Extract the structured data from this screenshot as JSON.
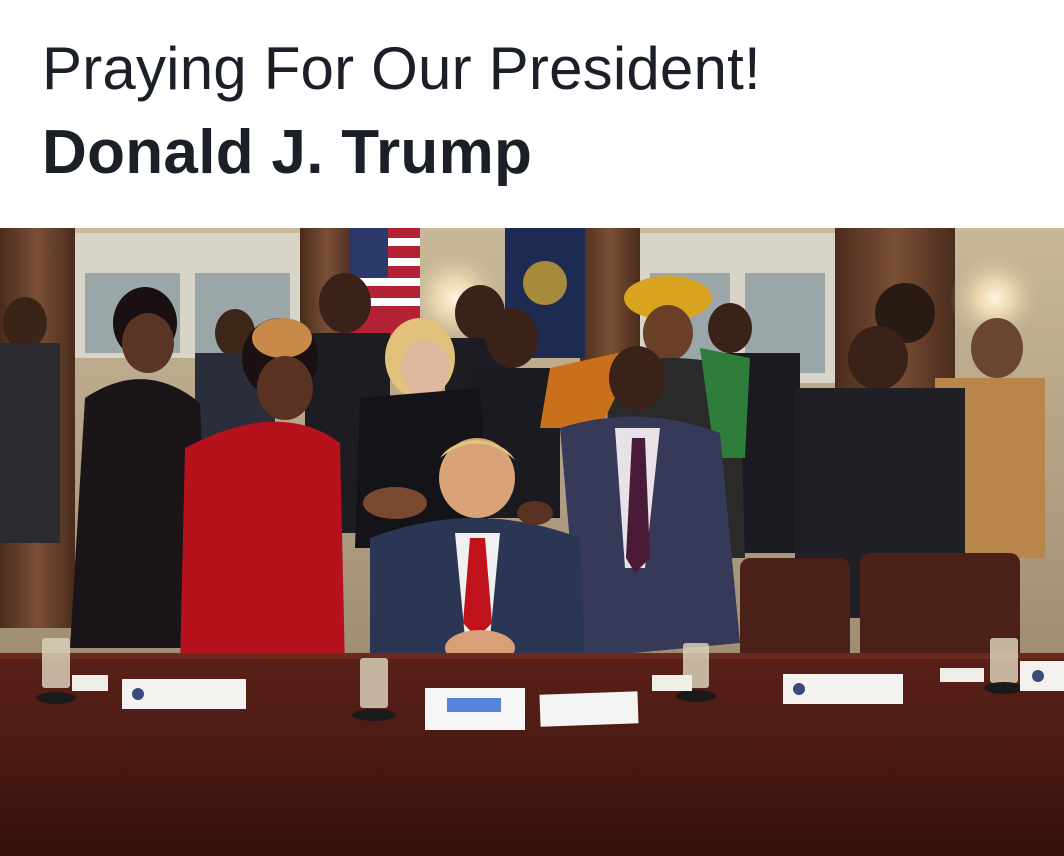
{
  "header": {
    "line1": "Praying For Our President!",
    "line2": "Donald J. Trump"
  },
  "photo": {
    "colors": {
      "wall": "#b8aa8c",
      "curtain": "#5a3a28",
      "table": "#4a1a14",
      "suit_navy": "#2b3554",
      "red_dress": "#b5121b",
      "tie_red": "#c0121a"
    }
  }
}
